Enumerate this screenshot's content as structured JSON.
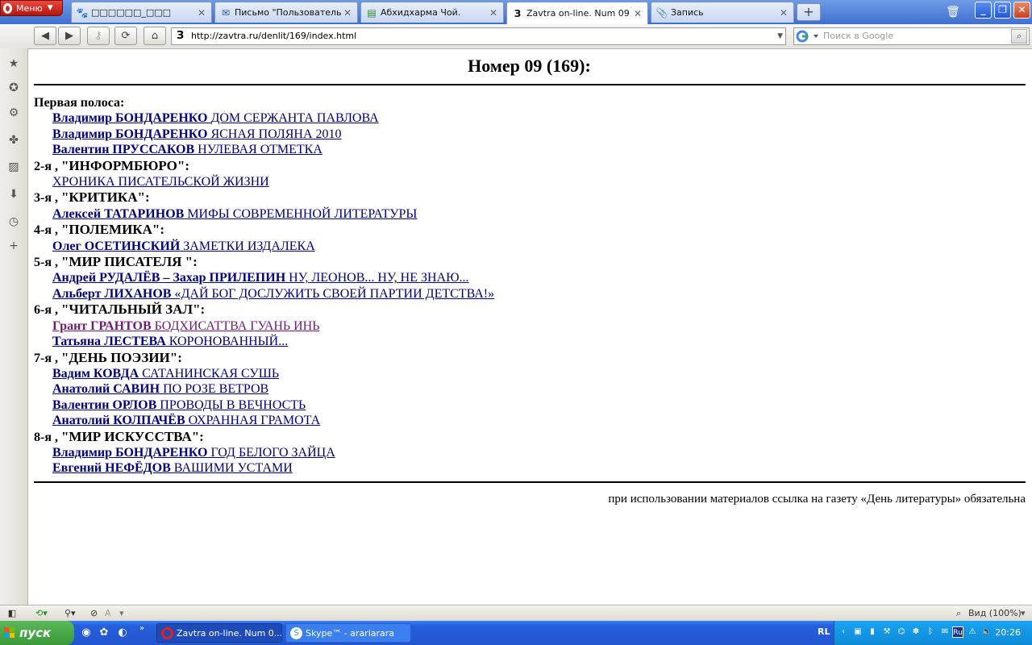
{
  "browser": {
    "menu_label": "Меню",
    "tabs": [
      {
        "icon": "paw-icon",
        "title": "□□□□□□_□□□"
      },
      {
        "icon": "mail-icon",
        "title": "Письмо \"Пользователь ..."
      },
      {
        "icon": "document-icon",
        "title": "Абхидхарма Чой."
      },
      {
        "icon": "zavtra-icon",
        "title": "Zavtra on-line. Num 09 (..."
      },
      {
        "icon": "paperclip-icon",
        "title": "Запись"
      }
    ],
    "url": "http://zavtra.ru/denlit/169/index.html",
    "search_placeholder": "Поиск в Google"
  },
  "page": {
    "title": "Номер 09 (169):",
    "sections": [
      {
        "num": "Первая полоса:",
        "title": "",
        "articles": [
          {
            "author": "Владимир БОНДАРЕНКО",
            "title": "ДОМ СЕРЖАНТА ПАВЛОВА",
            "visited": false
          },
          {
            "author": "Владимир БОНДАРЕНКО",
            "title": "ЯСНАЯ ПОЛЯНА 2010",
            "visited": false
          },
          {
            "author": "Валентин ПРУССАКОВ",
            "title": "НУЛЕВАЯ ОТМЕТКА",
            "visited": false
          }
        ]
      },
      {
        "num": "2-я ,",
        "title": "\"ИНФОРМБЮРО\":",
        "articles": [
          {
            "author": "",
            "title": "ХРОНИКА ПИСАТЕЛЬСКОЙ ЖИЗНИ",
            "visited": false
          }
        ]
      },
      {
        "num": "3-я ,",
        "title": "\"КРИТИКА\":",
        "articles": [
          {
            "author": "Алексей ТАТАРИНОВ",
            "title": "МИФЫ СОВРЕМЕННОЙ ЛИТЕРАТУРЫ",
            "visited": false
          }
        ]
      },
      {
        "num": "4-я ,",
        "title": "\"ПОЛЕМИКА\":",
        "articles": [
          {
            "author": "Олег ОСЕТИНСКИЙ",
            "title": "ЗАМЕТКИ ИЗДАЛЕКА",
            "visited": false
          }
        ]
      },
      {
        "num": "5-я ,",
        "title": "\"МИР ПИСАТЕЛЯ \":",
        "articles": [
          {
            "author": "Андрей РУДАЛЁВ – Захар ПРИЛЕПИН",
            "title": "НУ, ЛЕОНОВ... НУ, НЕ ЗНАЮ...",
            "visited": false
          },
          {
            "author": "Альберт ЛИХАНОВ",
            "title": "«ДАЙ БОГ ДОСЛУЖИТЬ СВОЕЙ ПАРТИИ ДЕТСТВА!»",
            "visited": false
          }
        ]
      },
      {
        "num": "6-я ,",
        "title": "\"ЧИТАЛЬНЫЙ ЗАЛ\":",
        "articles": [
          {
            "author": "Грант ГРАНТОВ",
            "title": "БОДХИСАТТВА ГУАНЬ ИНЬ",
            "visited": true
          },
          {
            "author": "Татьяна ЛЕСТЕВА",
            "title": "КОРОНОВАННЫЙ...",
            "visited": false
          }
        ]
      },
      {
        "num": "7-я ,",
        "title": "\"ДЕНЬ ПОЭЗИИ\":",
        "articles": [
          {
            "author": "Вадим КОВДА",
            "title": "САТАНИНСКАЯ СУШЬ",
            "visited": false
          },
          {
            "author": "Анатолий САВИН",
            "title": "ПО РОЗЕ ВЕТРОВ",
            "visited": false
          },
          {
            "author": "Валентин ОРЛОВ",
            "title": "ПРОВОДЫ В ВЕЧНОСТЬ",
            "visited": false
          },
          {
            "author": "Анатолий КОЛПАЧЁВ",
            "title": "ОХРАННАЯ ГРАМОТА",
            "visited": false
          }
        ]
      },
      {
        "num": "8-я ,",
        "title": "\"МИР ИСКУССТВА\":",
        "articles": [
          {
            "author": "Владимир БОНДАРЕНКО",
            "title": "ГОД БЕЛОГО ЗАЙЦА",
            "visited": false
          },
          {
            "author": "Евгений НЕФЁДОВ",
            "title": "ВАШИМИ УСТАМИ",
            "visited": false
          }
        ]
      }
    ],
    "footer": "при использовании материалов ссылка на газету «День литературы» обязательна"
  },
  "statusbar": {
    "font_btn": "A",
    "zoom_label": "Вид (100%)"
  },
  "taskbar": {
    "start_label": "пуск",
    "tasks": [
      {
        "icon": "opera-icon",
        "label": "Zavtra on-line. Num 0..."
      },
      {
        "icon": "skype-icon",
        "label": "Skype™ - arariarara"
      }
    ],
    "lang_left": "RL",
    "lang_tray": "Ru",
    "clock": "20:26"
  }
}
